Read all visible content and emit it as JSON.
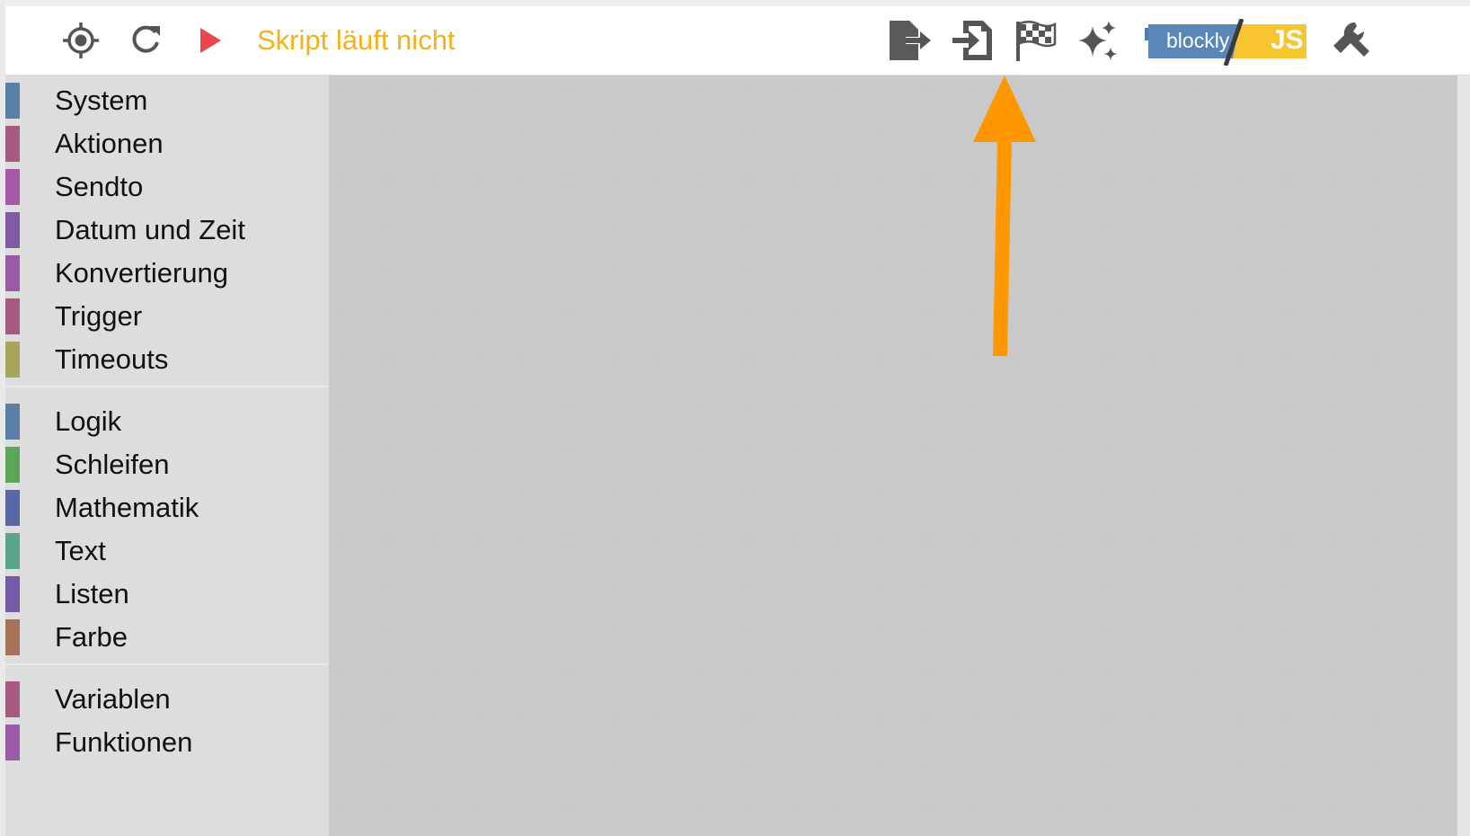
{
  "toolbar": {
    "status_text": "Skript läuft nicht",
    "status_color": "#f3b21a",
    "icons": {
      "target": "target-icon",
      "refresh": "refresh-icon",
      "run": "play-icon",
      "export": "export-icon",
      "import": "import-icon",
      "flag": "checkered-flag-icon",
      "sparkle": "sparkle-icon",
      "blockly_js": "blockly-js-toggle",
      "settings": "wrench-icon"
    },
    "blockly_label": "blockly",
    "js_label": "JS"
  },
  "sidebar": {
    "groups": [
      [
        {
          "label": "System",
          "color": "#5b80a5"
        },
        {
          "label": "Aktionen",
          "color": "#a55b80"
        },
        {
          "label": "Sendto",
          "color": "#a55ba5"
        },
        {
          "label": "Datum und Zeit",
          "color": "#805ba5"
        },
        {
          "label": "Konvertierung",
          "color": "#995ba5"
        },
        {
          "label": "Trigger",
          "color": "#a55b80"
        },
        {
          "label": "Timeouts",
          "color": "#a5a55b"
        }
      ],
      [
        {
          "label": "Logik",
          "color": "#5b80a5"
        },
        {
          "label": "Schleifen",
          "color": "#5ba55b"
        },
        {
          "label": "Mathematik",
          "color": "#5b67a5"
        },
        {
          "label": "Text",
          "color": "#5ba58c"
        },
        {
          "label": "Listen",
          "color": "#745ba5"
        },
        {
          "label": "Farbe",
          "color": "#a5745b"
        }
      ],
      [
        {
          "label": "Variablen",
          "color": "#a55b80"
        },
        {
          "label": "Funktionen",
          "color": "#995ba5"
        }
      ]
    ]
  },
  "annotation": {
    "arrow_color": "#ff9800"
  }
}
